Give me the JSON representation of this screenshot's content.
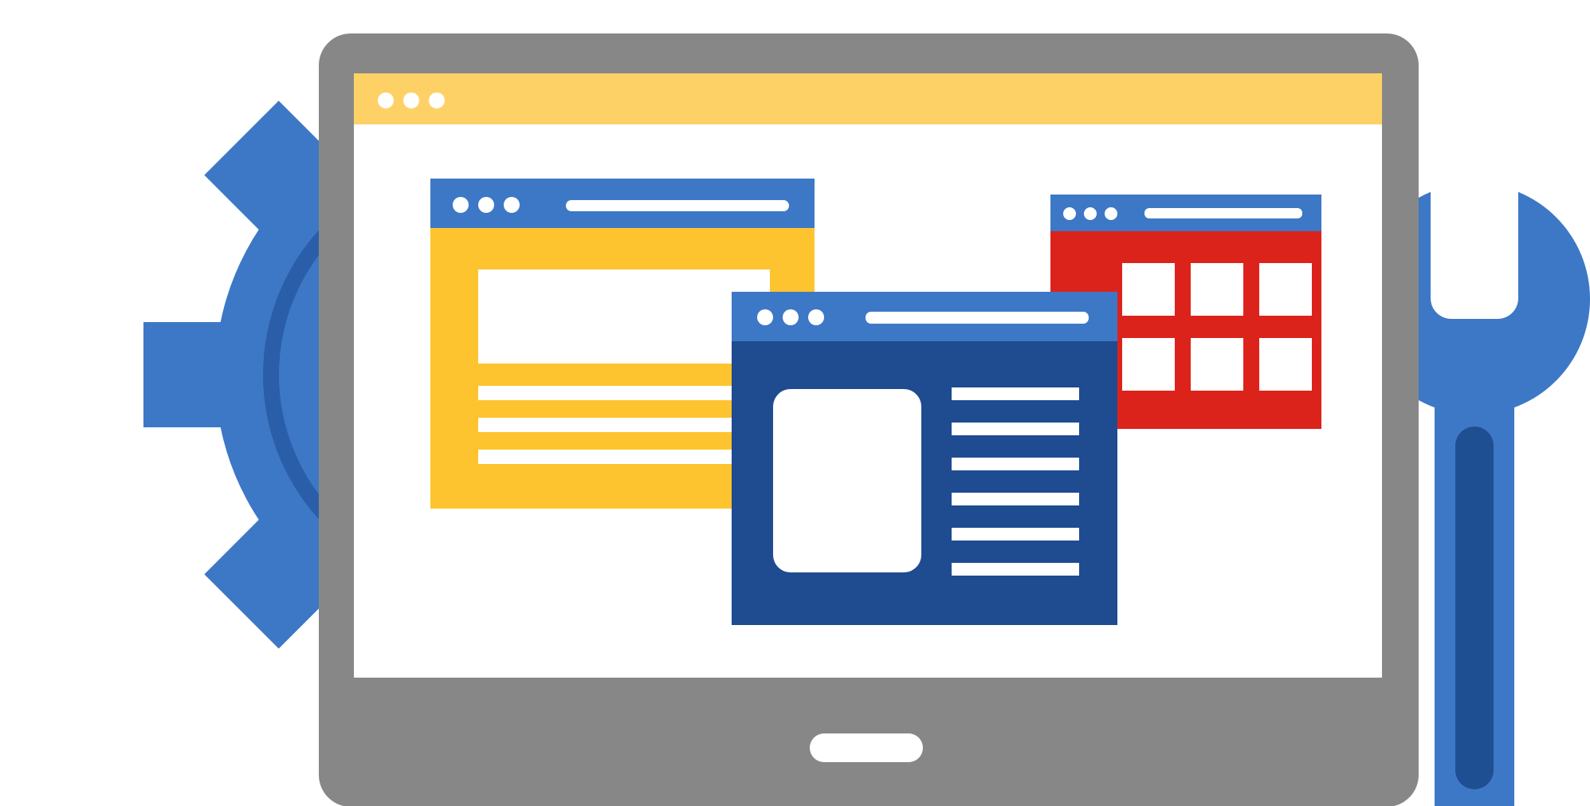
{
  "illustration": {
    "subject": [
      "gear-icon",
      "wrench-icon",
      "tablet-device",
      "browser-window-yellow",
      "browser-window-red",
      "browser-window-blue"
    ]
  },
  "colors": {
    "background": "#ffffff",
    "gear": "#3d78c6",
    "gear_ring": "#2a5ea8",
    "wrench": "#3d78c6",
    "wrench_slot": "#1f4f93",
    "tablet_frame": "#878787",
    "screen": "#ffffff",
    "tablet_titlebar": "#fdd165",
    "window_yellow": "#fec430",
    "window_red": "#dc231b",
    "window_blue": "#1f4b91",
    "titlebar_blue": "#3d78c6",
    "white": "#ffffff"
  }
}
